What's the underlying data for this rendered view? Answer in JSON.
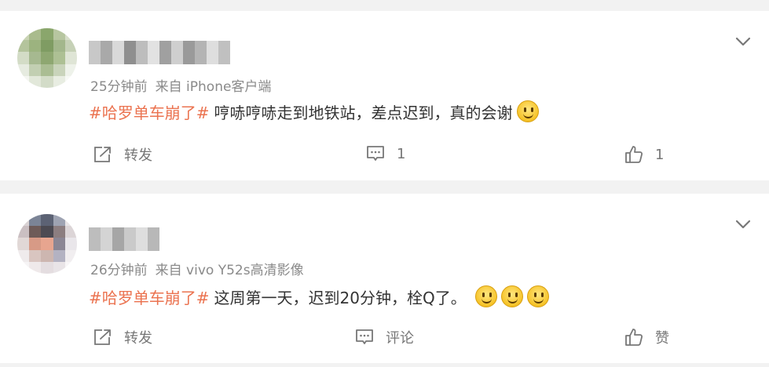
{
  "posts": [
    {
      "time": "25分钟前",
      "source": "来自 iPhone客户端",
      "topic": "#哈罗单车崩了#",
      "text": "哼哧哼哧走到地铁站，差点迟到，真的会谢",
      "emoji_count": 1,
      "forward_label": "转发",
      "comment_label": "1",
      "like_label": "1",
      "avatar_colors": [
        "#c9d3b4",
        "#a9bb8d",
        "#8aa66c",
        "#b7c6a0",
        "#d7dec9",
        "#b4c49c",
        "#9cb37f",
        "#7f9c63",
        "#a3b78c",
        "#c6d1b7",
        "#d3dcc6",
        "#a6b990",
        "#8ea771",
        "#adc094",
        "#dfe5d6",
        "#e6ebe0",
        "#c2cfb2",
        "#aabd93",
        "#c9d4bb",
        "#eef2ea",
        "#f4f6f1",
        "#e2e8da",
        "#d3dcc8",
        "#e8ede2",
        "#f7f9f5"
      ],
      "name_colors": [
        "#c8c8c8",
        "#a9a9a9",
        "#d9d9d9",
        "#8f8f8f",
        "#bdbdbd",
        "#e2e2e2",
        "#a0a0a0",
        "#cfcfcf",
        "#9a9a9a",
        "#b4b4b4",
        "#dedede",
        "#c0c0c0"
      ]
    },
    {
      "time": "26分钟前",
      "source": "来自 vivo Y52s高清影像",
      "topic": "#哈罗单车崩了#",
      "text": "这周第一天，迟到20分钟，栓Q了。",
      "emoji_count": 3,
      "forward_label": "转发",
      "comment_label": "评论",
      "like_label": "赞",
      "avatar_colors": [
        "#d9d2d4",
        "#7b8496",
        "#5c6274",
        "#9ea3b2",
        "#e8e4e6",
        "#cabfc2",
        "#6e5b58",
        "#4c4a52",
        "#8c7e80",
        "#dcd5d7",
        "#e1d8d6",
        "#d79a86",
        "#e7a58f",
        "#8b8694",
        "#e9e6ea",
        "#efebec",
        "#d9c5c0",
        "#cdb6b0",
        "#b3b2c2",
        "#f1eef0",
        "#f6f4f5",
        "#efe9ea",
        "#e4dde0",
        "#e9e4e7",
        "#f8f6f7"
      ],
      "name_colors": [
        "#bdbdbd",
        "#d4d4d4",
        "#a6a6a6",
        "#cacaca",
        "#dedede",
        "#b8b8b8"
      ]
    }
  ],
  "icons": {
    "forward": "share-arrow-icon",
    "comment": "comment-bubble-icon",
    "like": "thumbs-up-icon",
    "expand": "chevron-down-icon",
    "emoji": "smiley-face-icon"
  },
  "colors": {
    "topic": "#eb7350",
    "text": "#333333",
    "meta": "#8a8a8a",
    "background": "#f2f2f2"
  }
}
